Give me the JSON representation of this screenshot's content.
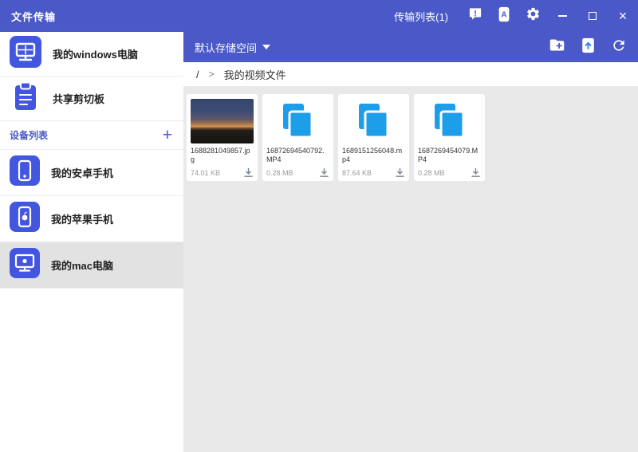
{
  "colors": {
    "titlebar_bg": "#4a58c8",
    "accent_blue": "#4356e0",
    "file_icon_blue": "#1d9ee8",
    "selected_bg": "#e2e2e2",
    "content_bg": "#e9e9e9"
  },
  "titlebar": {
    "title": "文件传输",
    "transfer_list_label": "传输列表(1)",
    "window_controls": {
      "close": "×"
    }
  },
  "sidebar": {
    "items": [
      {
        "label": "我的windows电脑"
      },
      {
        "label": "共享剪切板"
      }
    ],
    "device_section": {
      "label": "设备列表",
      "add_label": "+"
    },
    "devices": [
      {
        "label": "我的安卓手机",
        "selected": false
      },
      {
        "label": "我的苹果手机",
        "selected": false
      },
      {
        "label": "我的mac电脑",
        "selected": true
      }
    ]
  },
  "toolbar": {
    "storage_dropdown_label": "默认存储空间"
  },
  "breadcrumb": {
    "root": "/",
    "separator": ">",
    "current": "我的视频文件"
  },
  "files": [
    {
      "name": "1688281049857.jpg",
      "size": "74.01 KB",
      "type": "image"
    },
    {
      "name": "16872694540792.MP4",
      "size": "0.28 MB",
      "type": "video"
    },
    {
      "name": "1689151256048.mp4",
      "size": "87.64 KB",
      "type": "video"
    },
    {
      "name": "1687269454079.MP4",
      "size": "0.28 MB",
      "type": "video"
    }
  ]
}
